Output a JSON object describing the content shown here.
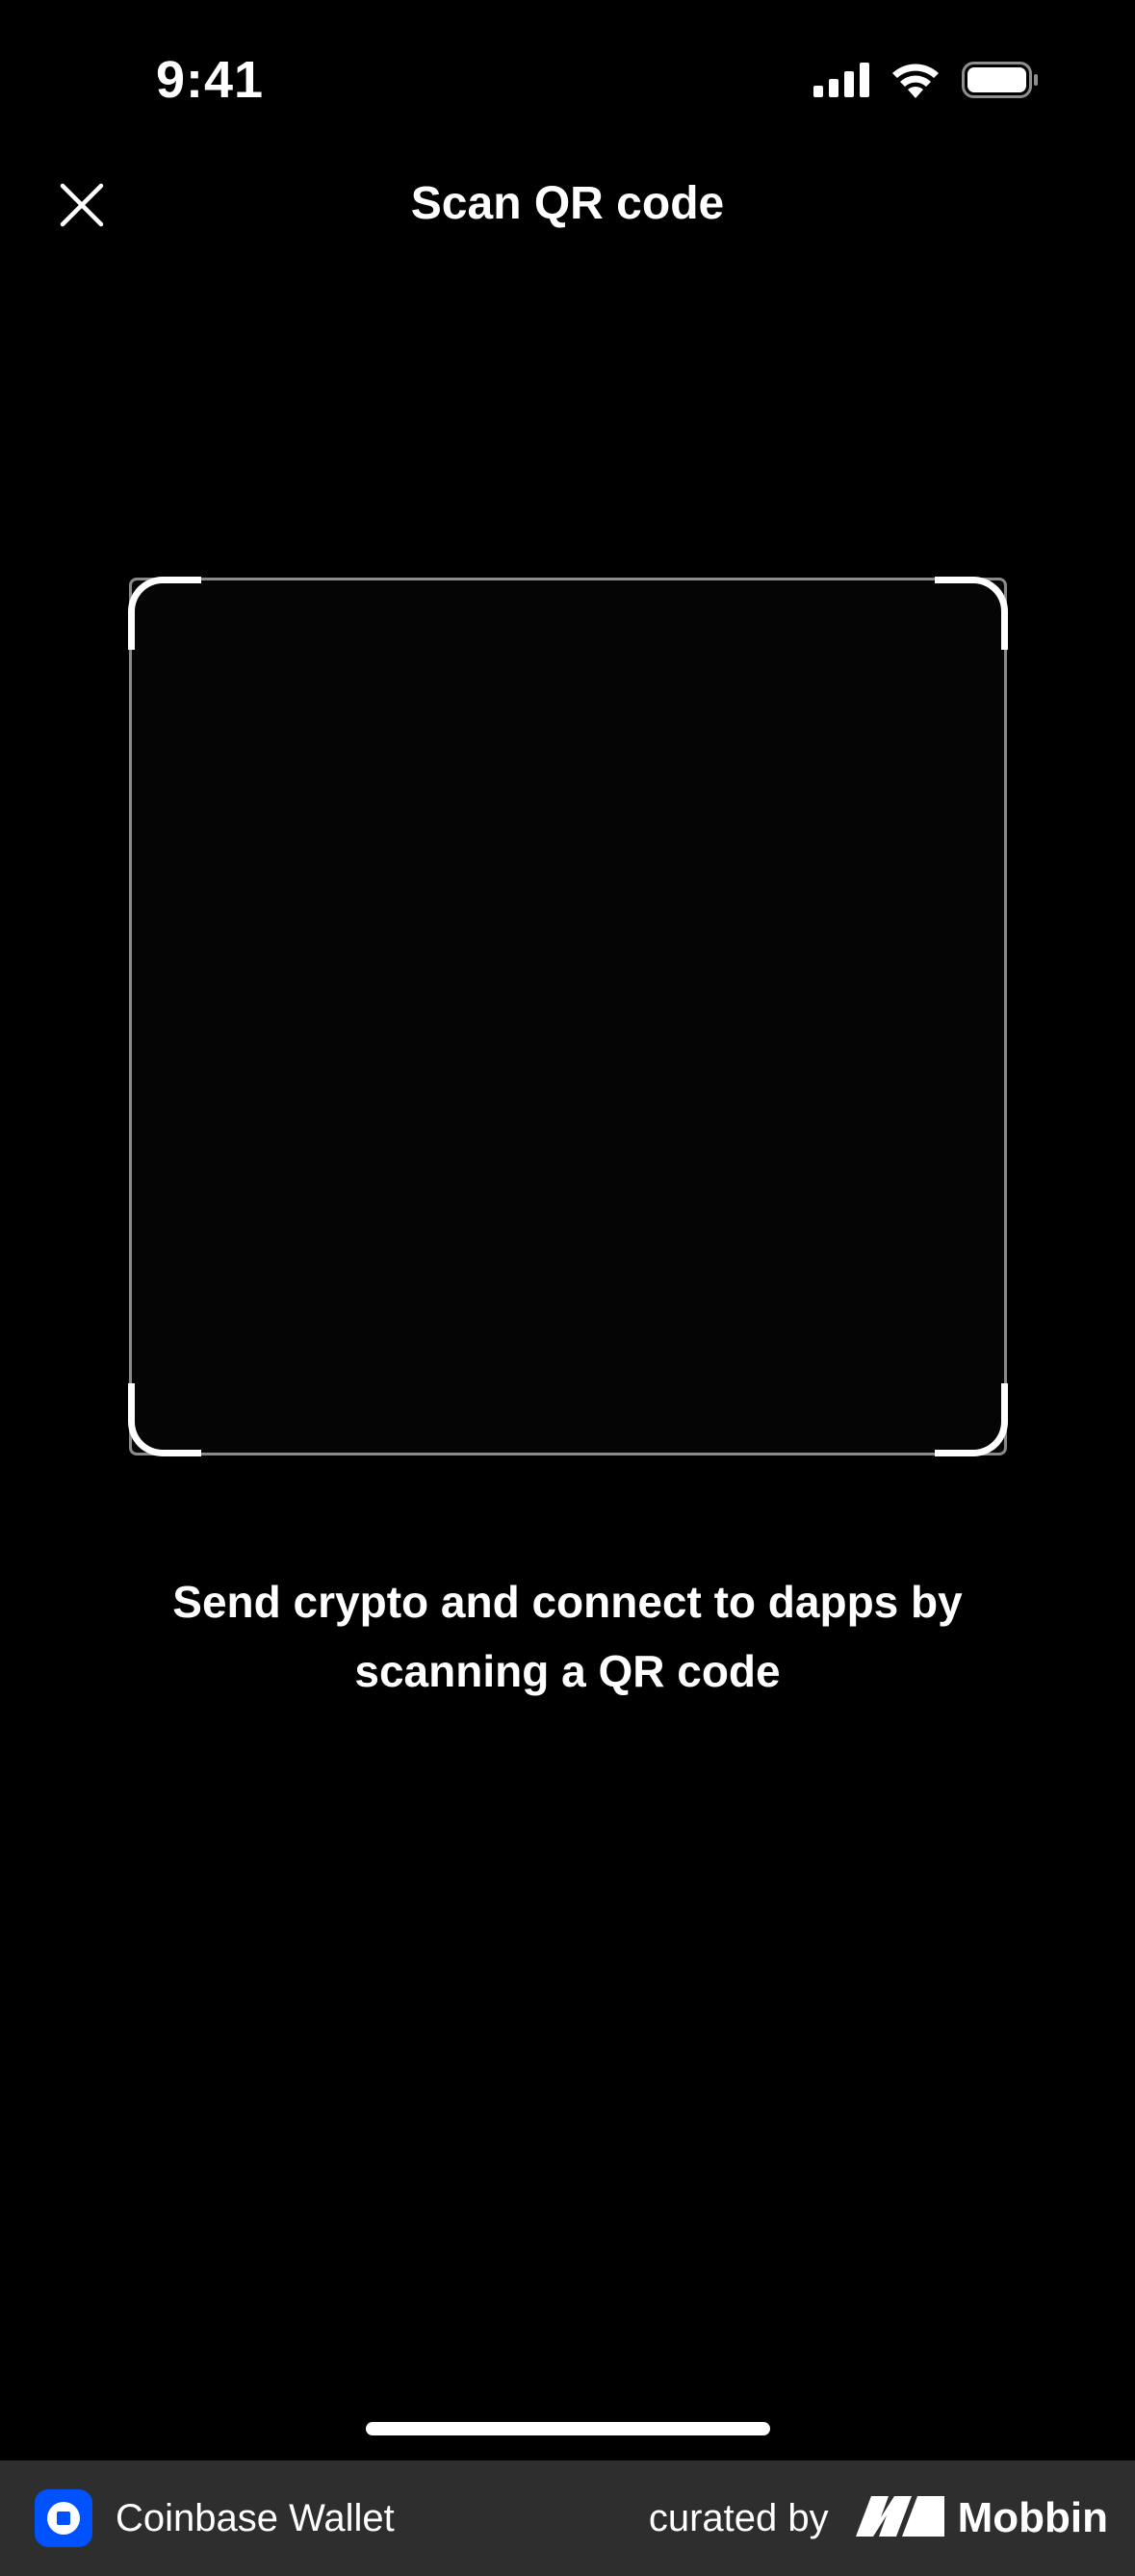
{
  "status_bar": {
    "time": "9:41",
    "icons": [
      "cellular-signal-icon",
      "wifi-icon",
      "battery-icon"
    ]
  },
  "nav": {
    "close_icon": "close-icon",
    "title": "Scan QR code"
  },
  "scanner": {
    "instructions": "Send crypto and connect to dapps by scanning a QR code"
  },
  "footer": {
    "app_name": "Coinbase Wallet",
    "curated_by": "curated by",
    "brand": "Mobbin",
    "app_logo_color": "#0052ff"
  },
  "colors": {
    "background": "#000000",
    "text": "#ffffff",
    "footer_bg": "#2e2e2e",
    "frame_border": "#8a8a8a"
  }
}
